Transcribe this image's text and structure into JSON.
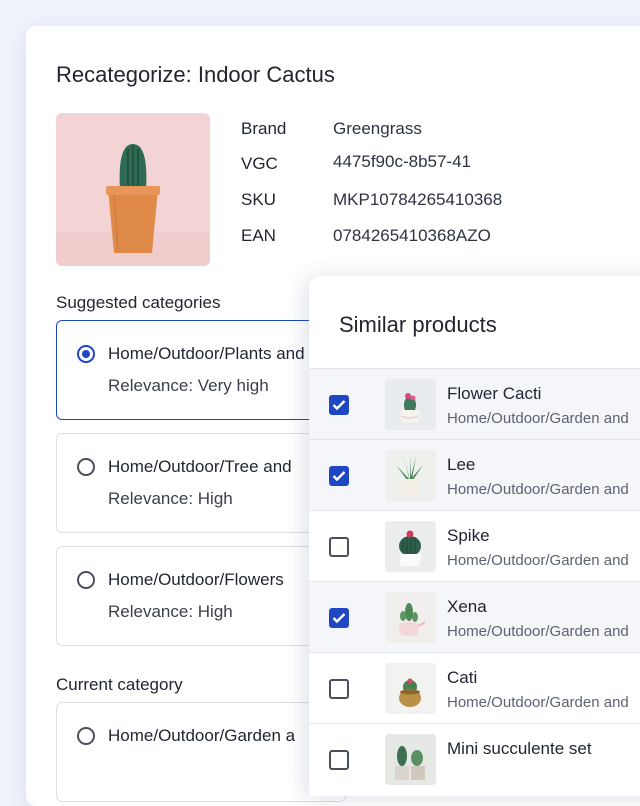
{
  "recategorize": {
    "title": "Recategorize: Indoor Cactus",
    "specs": [
      {
        "label": "Brand",
        "value": "Greengrass"
      },
      {
        "label": "VGC",
        "value": "4475f90c-8b57-41"
      },
      {
        "label": "SKU",
        "value": "MKP10784265410368"
      },
      {
        "label": "EAN",
        "value": "0784265410368AZO"
      }
    ],
    "suggested_label": "Suggested categories",
    "suggested": [
      {
        "path": "Home/Outdoor/Plants and",
        "relevance": "Relevance: Very high",
        "selected": true
      },
      {
        "path": "Home/Outdoor/Tree and",
        "relevance": "Relevance: High",
        "selected": false
      },
      {
        "path": "Home/Outdoor/Flowers",
        "relevance": "Relevance: High",
        "selected": false
      }
    ],
    "current_label": "Current category",
    "current": {
      "path": "Home/Outdoor/Garden a",
      "selected": false
    }
  },
  "similar": {
    "title": "Similar products",
    "items": [
      {
        "name": "Flower Cacti",
        "category": "Home/Outdoor/Garden and",
        "checked": true,
        "thumb": "pink-cactus-pot-thumbnail"
      },
      {
        "name": "Lee",
        "category": "Home/Outdoor/Garden and",
        "checked": true,
        "thumb": "aloe-plant-thumbnail"
      },
      {
        "name": "Spike",
        "category": "Home/Outdoor/Garden and",
        "checked": false,
        "thumb": "round-cactus-thumbnail"
      },
      {
        "name": "Xena",
        "category": "Home/Outdoor/Garden and",
        "checked": true,
        "thumb": "cactus-teapot-thumbnail"
      },
      {
        "name": "Cati",
        "category": "Home/Outdoor/Garden and",
        "checked": false,
        "thumb": "gold-pot-cactus-thumbnail"
      },
      {
        "name": "Mini succulente set",
        "category": "",
        "checked": false,
        "thumb": "succulent-set-thumbnail"
      }
    ]
  },
  "colors": {
    "accent": "#1f47c4",
    "background": "#eef2fb",
    "pot": "#e08a4a",
    "product_bg": "#f3d3d3"
  }
}
